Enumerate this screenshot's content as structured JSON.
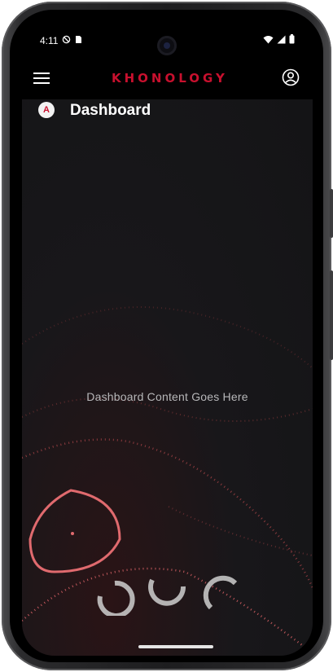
{
  "status_bar": {
    "time": "4:11",
    "icons": [
      "do-not-disturb-icon",
      "sim-card-icon",
      "wifi-icon",
      "cellular-signal-icon",
      "battery-icon"
    ]
  },
  "app_bar": {
    "logo_text": "KHONOLOGY",
    "menu_icon": "hamburger-menu-icon",
    "account_icon": "account-circle-icon"
  },
  "page": {
    "icon_letter": "A",
    "title": "Dashboard",
    "placeholder": "Dashboard Content Goes Here"
  },
  "colors": {
    "brand": "#c8102e",
    "background": "#141416",
    "app_bar": "#000000",
    "placeholder_text": "#b7b7b9"
  }
}
